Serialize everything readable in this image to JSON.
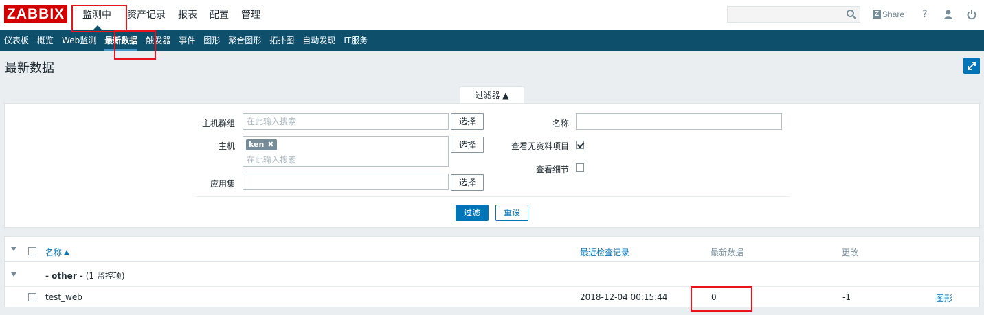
{
  "header": {
    "logo": "ZABBIX",
    "menu": [
      "监测中",
      "资产记录",
      "报表",
      "配置",
      "管理"
    ],
    "share_label": "Share",
    "help_icon": "?"
  },
  "submenu": [
    "仪表板",
    "概览",
    "Web监测",
    "最新数据",
    "触发器",
    "事件",
    "图形",
    "聚合图形",
    "拓扑图",
    "自动发现",
    "IT服务"
  ],
  "page": {
    "title": "最新数据"
  },
  "filter": {
    "tab_label": "过滤器 ▲",
    "host_group_label": "主机群组",
    "host_group_placeholder": "在此输入搜索",
    "host_label": "主机",
    "host_tag": "ken",
    "host_placeholder": "在此输入搜索",
    "application_label": "应用集",
    "select_label": "选择",
    "name_label": "名称",
    "name_value": "",
    "show_items_without_data_label": "查看无资料项目",
    "show_items_without_data": true,
    "show_details_label": "查看细节",
    "show_details": false,
    "apply_label": "过滤",
    "reset_label": "重设"
  },
  "table": {
    "headers": {
      "name": "名称",
      "last_check": "最近检查记录",
      "last_value": "最新数据",
      "change": "更改"
    },
    "group": {
      "name": "- other -",
      "count": "(1 监控项)"
    },
    "rows": [
      {
        "name": "test_web",
        "last_check": "2018-12-04 00:15:44",
        "last_value": "0",
        "change": "-1",
        "action": "图形"
      }
    ]
  },
  "colors": {
    "accent": "#0275b8",
    "nav": "#0e4f6c",
    "logo": "#d40000",
    "highlight": "#e8161a"
  }
}
